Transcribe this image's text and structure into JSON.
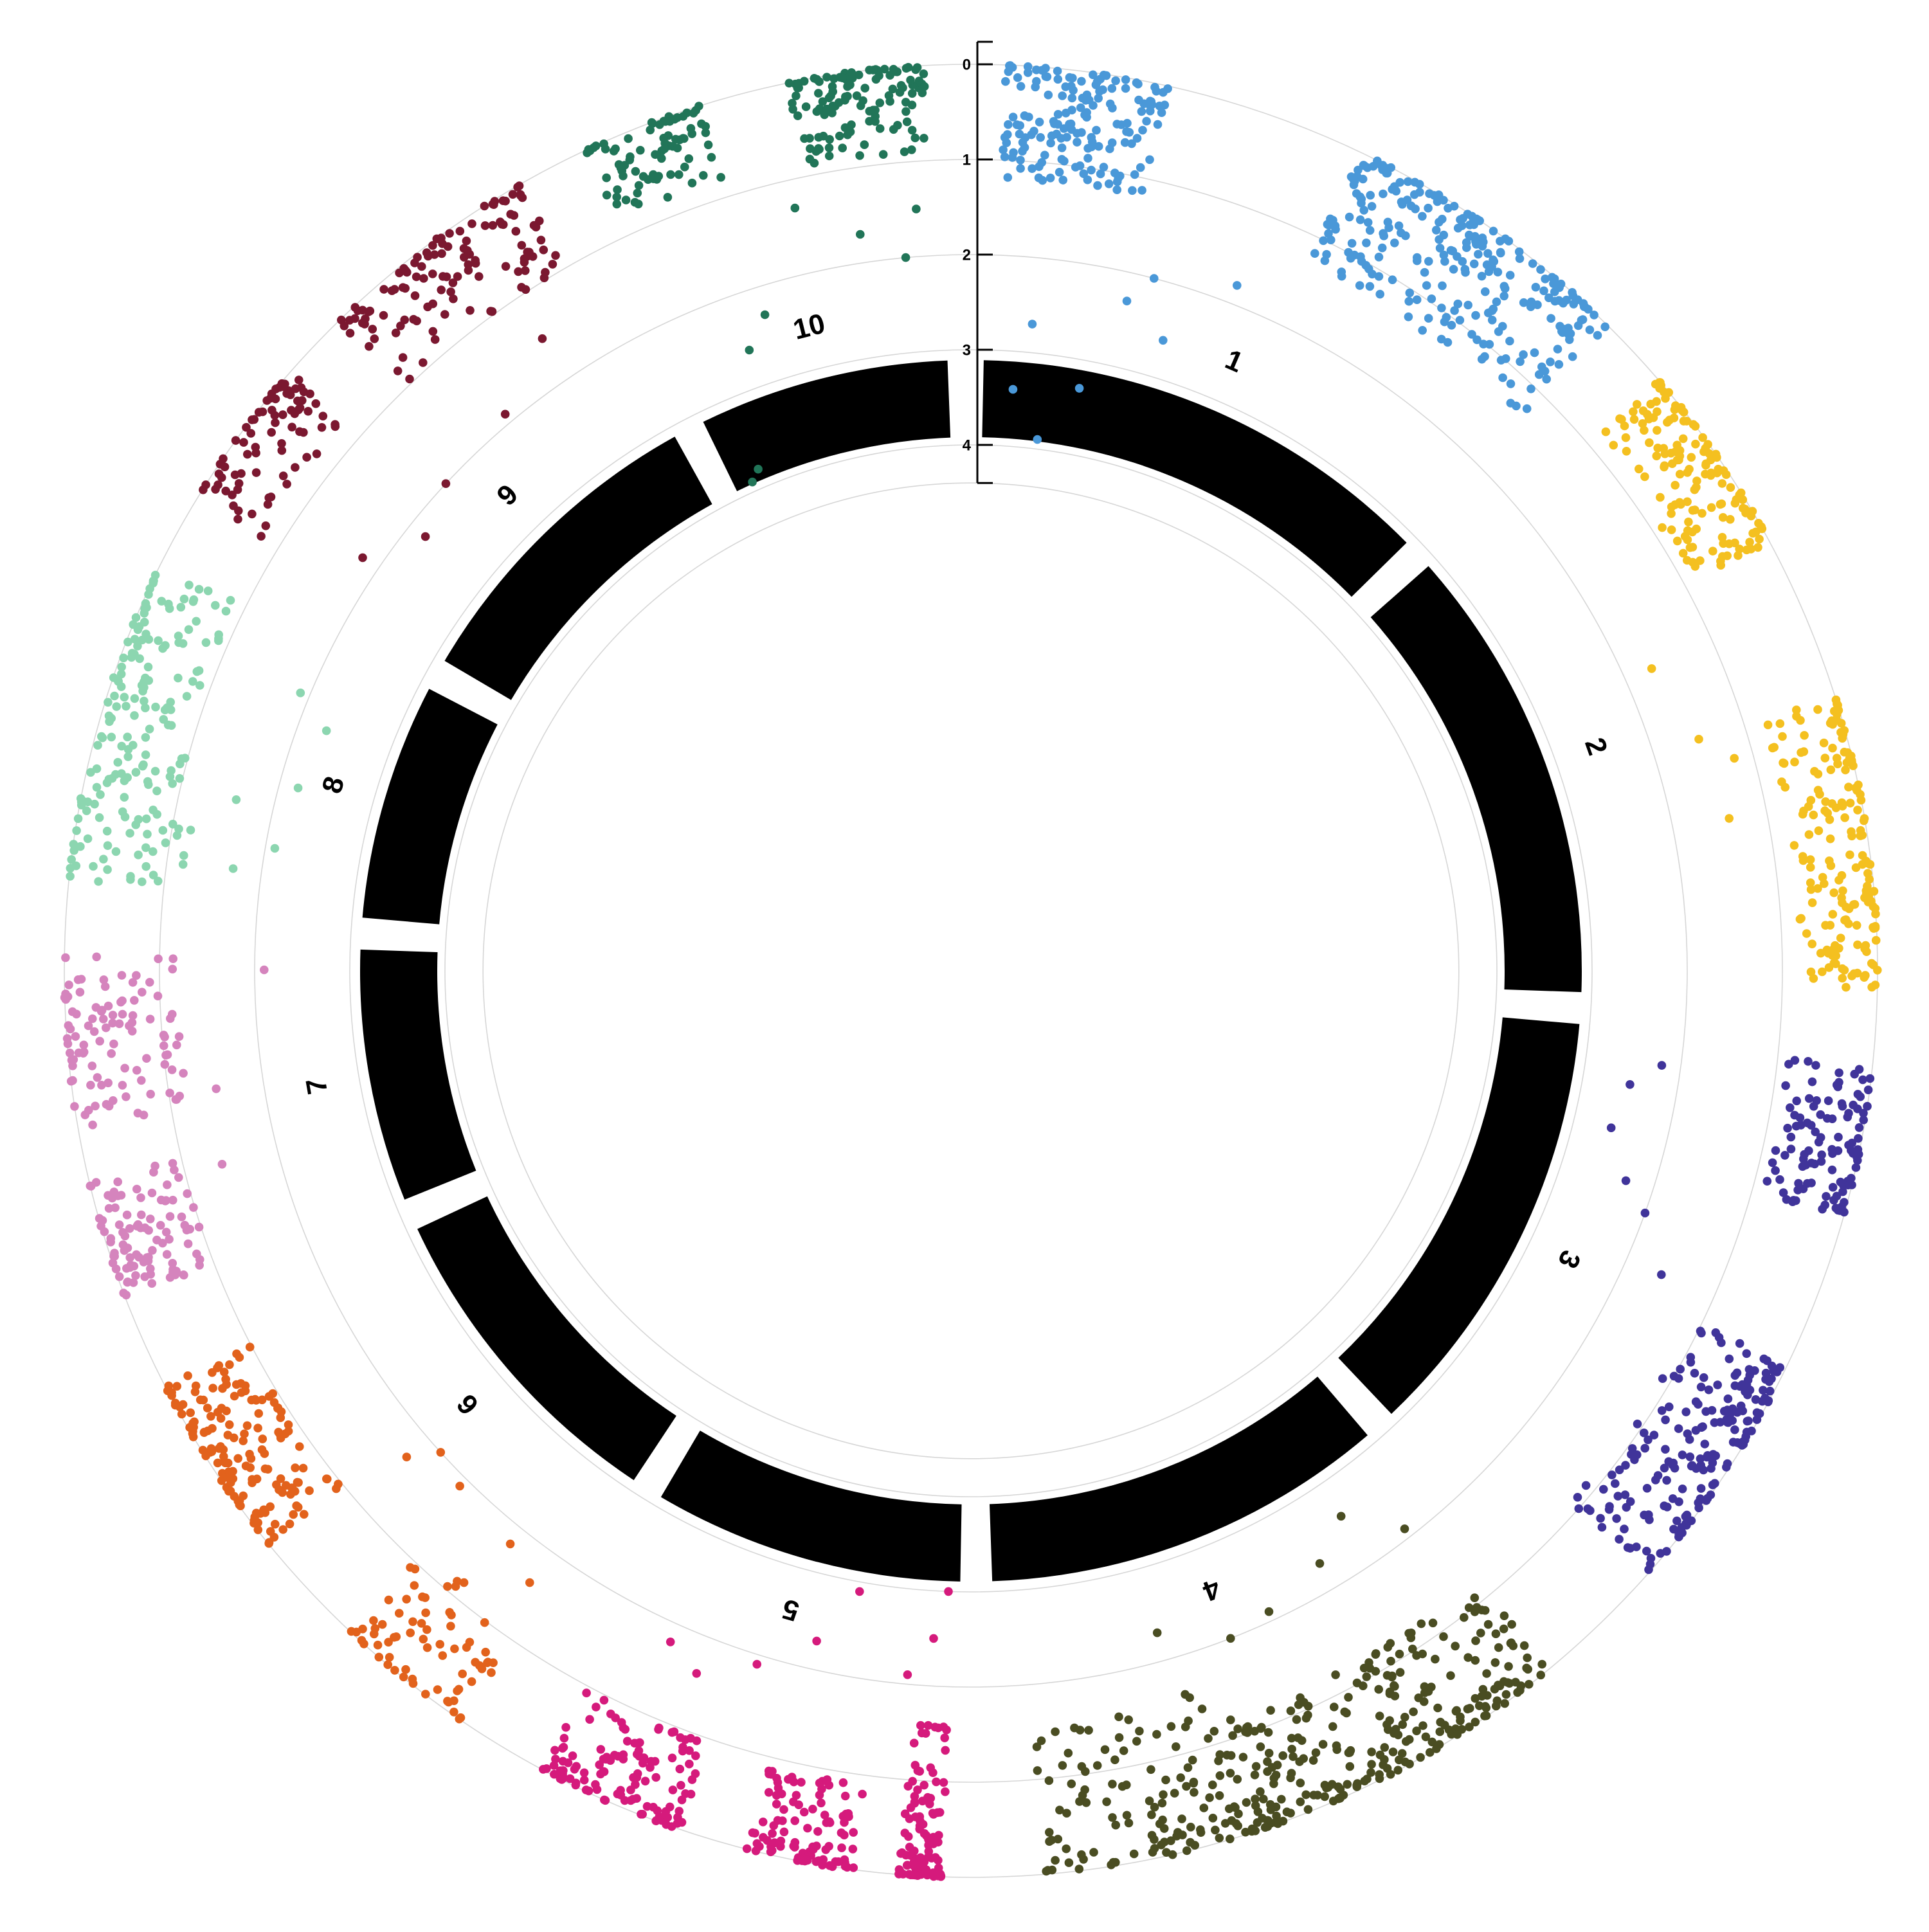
{
  "chart_data": {
    "type": "scatter",
    "layout": "circular",
    "title": "",
    "radial_axis": {
      "ticks": [
        "0",
        "1",
        "2",
        "3",
        "4"
      ],
      "range": [
        0,
        4.4
      ],
      "direction": "inward",
      "grid": true
    },
    "chromosome_ring_color": "#000000",
    "chromosomes": [
      {
        "label": "1",
        "arc_deg": [
          1.2,
          45.5
        ],
        "color": "#4a98d8"
      },
      {
        "label": "2",
        "arc_deg": [
          48.5,
          92.0
        ],
        "color": "#f4c020"
      },
      {
        "label": "3",
        "arc_deg": [
          95.0,
          136.5
        ],
        "color": "#40349a"
      },
      {
        "label": "4",
        "arc_deg": [
          139.5,
          178.0
        ],
        "color": "#4a4d22"
      },
      {
        "label": "5",
        "arc_deg": [
          181.0,
          210.5
        ],
        "color": "#d51a7c"
      },
      {
        "label": "6",
        "arc_deg": [
          213.5,
          245.0
        ],
        "color": "#e2621c"
      },
      {
        "label": "7",
        "arc_deg": [
          248.0,
          272.0
        ],
        "color": "#d584bd"
      },
      {
        "label": "8",
        "arc_deg": [
          275.0,
          297.5
        ],
        "color": "#8cd6b0"
      },
      {
        "label": "9",
        "arc_deg": [
          300.5,
          331.0
        ],
        "color": "#7b1830"
      },
      {
        "label": "10",
        "arc_deg": [
          334.0,
          357.8
        ],
        "color": "#217558"
      }
    ],
    "series": [
      {
        "chromosome": "1",
        "count": 420,
        "clusters": [
          {
            "pos": [
              0.0,
              0.25
            ],
            "weight": 5,
            "depth_max": 1.2
          },
          {
            "pos": [
              0.55,
              1.0
            ],
            "weight": 8,
            "depth_max": 1.3
          }
        ],
        "outliers": [
          [
            0.05,
            3.4
          ],
          [
            0.08,
            2.7
          ],
          [
            0.12,
            3.9
          ],
          [
            0.2,
            3.3
          ],
          [
            0.26,
            2.3
          ],
          [
            0.3,
            2.0
          ],
          [
            0.35,
            2.6
          ],
          [
            0.45,
            1.8
          ]
        ]
      },
      {
        "chromosome": "2",
        "count": 330,
        "clusters": [
          {
            "pos": [
              0.0,
              0.3
            ],
            "weight": 6,
            "depth_max": 0.9
          },
          {
            "pos": [
              0.55,
              1.0
            ],
            "weight": 7,
            "depth_max": 0.8
          }
        ],
        "outliers": [
          [
            0.4,
            1.7
          ],
          [
            0.55,
            1.5
          ],
          [
            0.6,
            1.2
          ],
          [
            0.7,
            1.4
          ]
        ]
      },
      {
        "chromosome": "3",
        "count": 300,
        "clusters": [
          {
            "pos": [
              0.0,
              0.25
            ],
            "weight": 4,
            "depth_max": 0.9
          },
          {
            "pos": [
              0.5,
              0.9
            ],
            "weight": 7,
            "depth_max": 1.1
          }
        ],
        "outliers": [
          [
            0.05,
            2.2
          ],
          [
            0.1,
            2.5
          ],
          [
            0.2,
            2.6
          ],
          [
            0.3,
            2.3
          ],
          [
            0.35,
            2.0
          ],
          [
            0.45,
            1.6
          ]
        ]
      },
      {
        "chromosome": "4",
        "count": 380,
        "clusters": [
          {
            "pos": [
              0.0,
              0.6
            ],
            "weight": 9,
            "depth_max": 1.2
          },
          {
            "pos": [
              0.6,
              0.95
            ],
            "weight": 4,
            "depth_max": 1.6
          }
        ],
        "outliers": [
          [
            0.05,
            2.1
          ],
          [
            0.15,
            2.6
          ],
          [
            0.25,
            2.3
          ],
          [
            0.4,
            2.1
          ],
          [
            0.5,
            2.0
          ],
          [
            0.65,
            2.3
          ]
        ]
      },
      {
        "chromosome": "5",
        "count": 330,
        "clusters": [
          {
            "pos": [
              0.0,
              0.1
            ],
            "weight": 5,
            "depth_max": 1.6
          },
          {
            "pos": [
              0.2,
              0.45
            ],
            "weight": 5,
            "depth_max": 0.9
          },
          {
            "pos": [
              0.6,
              0.95
            ],
            "weight": 6,
            "depth_max": 1.0
          }
        ],
        "outliers": [
          [
            0.01,
            3.0
          ],
          [
            0.05,
            2.5
          ],
          [
            0.12,
            2.1
          ],
          [
            0.3,
            2.9
          ],
          [
            0.4,
            2.3
          ],
          [
            0.55,
            1.9
          ],
          [
            0.7,
            1.6
          ],
          [
            0.8,
            1.8
          ]
        ]
      },
      {
        "chromosome": "6",
        "count": 230,
        "clusters": [
          {
            "pos": [
              0.0,
              0.3
            ],
            "weight": 3,
            "depth_max": 1.2
          },
          {
            "pos": [
              0.55,
              0.95
            ],
            "weight": 7,
            "depth_max": 1.0
          }
        ],
        "outliers": [
          [
            0.05,
            1.6
          ],
          [
            0.15,
            1.8
          ],
          [
            0.35,
            1.9
          ],
          [
            0.45,
            2.0
          ],
          [
            0.5,
            1.7
          ]
        ]
      },
      {
        "chromosome": "7",
        "count": 200,
        "clusters": [
          {
            "pos": [
              0.0,
              0.35
            ],
            "weight": 5,
            "depth_max": 1.0
          },
          {
            "pos": [
              0.5,
              1.0
            ],
            "weight": 5,
            "depth_max": 1.2
          }
        ],
        "outliers": [
          [
            0.3,
            1.4
          ],
          [
            0.55,
            1.5
          ],
          [
            0.95,
            2.1
          ]
        ]
      },
      {
        "chromosome": "8",
        "count": 180,
        "clusters": [
          {
            "pos": [
              0.0,
              0.5
            ],
            "weight": 5,
            "depth_max": 1.2
          },
          {
            "pos": [
              0.5,
              1.0
            ],
            "weight": 5,
            "depth_max": 0.9
          }
        ],
        "outliers": [
          [
            0.1,
            1.7
          ],
          [
            0.2,
            2.1
          ],
          [
            0.35,
            1.6
          ],
          [
            0.45,
            2.2
          ],
          [
            0.7,
            2.3
          ],
          [
            0.8,
            1.9
          ]
        ]
      },
      {
        "chromosome": "9",
        "count": 200,
        "clusters": [
          {
            "pos": [
              0.0,
              0.35
            ],
            "weight": 4,
            "depth_max": 0.8
          },
          {
            "pos": [
              0.5,
              1.0
            ],
            "weight": 6,
            "depth_max": 1.0
          }
        ],
        "outliers": [
          [
            0.1,
            1.8
          ],
          [
            0.25,
            2.2
          ],
          [
            0.4,
            2.0
          ],
          [
            0.65,
            1.9
          ],
          [
            0.85,
            1.5
          ]
        ]
      },
      {
        "chromosome": "10",
        "count": 200,
        "clusters": [
          {
            "pos": [
              0.0,
              0.35
            ],
            "weight": 4,
            "depth_max": 0.8
          },
          {
            "pos": [
              0.6,
              1.0
            ],
            "weight": 6,
            "depth_max": 0.9
          }
        ],
        "outliers": [
          [
            0.05,
            3.9
          ],
          [
            0.1,
            3.8
          ],
          [
            0.25,
            2.6
          ],
          [
            0.35,
            2.3
          ],
          [
            0.55,
            1.3
          ],
          [
            0.75,
            1.7
          ],
          [
            0.9,
            2.0
          ],
          [
            0.95,
            1.5
          ]
        ]
      }
    ]
  }
}
